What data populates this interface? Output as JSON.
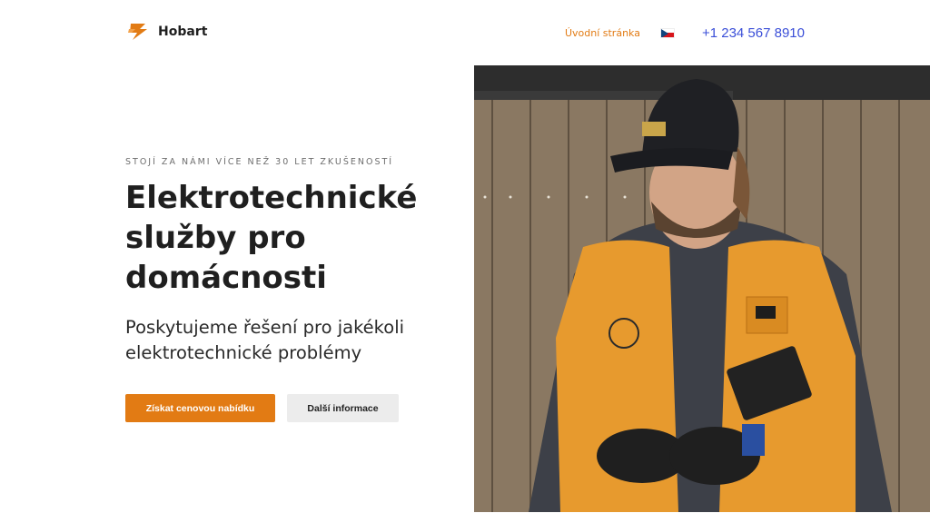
{
  "header": {
    "brand": "Hobart",
    "logo_icon": "lightning-bolt-logo-icon",
    "nav_home": "Úvodní stránka",
    "language_flag": "czech-flag-icon",
    "phone": "+1 234 567 8910"
  },
  "hero": {
    "eyebrow": "STOJÍ ZA NÁMI VÍCE NEŽ 30 LET ZKUŠENOSTÍ",
    "title": "Elektrotechnické služby pro domácnosti",
    "subtitle": "Poskytujeme řešení pro jakékoli elektrotechnické problémy",
    "cta_primary": "Získat cenovou nabídku",
    "cta_secondary": "Další informace",
    "image": "electrician-in-orange-vest-photo"
  },
  "colors": {
    "accent": "#e27b14",
    "phone_link": "#3b4fd8",
    "secondary_button": "#ececec",
    "text_dark": "#1f1f1f"
  }
}
